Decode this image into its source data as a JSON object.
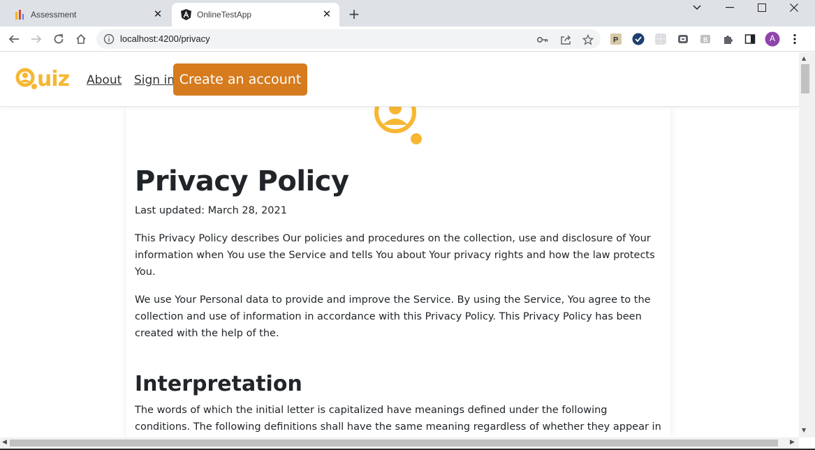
{
  "browser": {
    "tabs": [
      {
        "title": "Assessment",
        "active": false
      },
      {
        "title": "OnlineTestApp",
        "active": true
      }
    ],
    "url": "localhost:4200/privacy",
    "profile_initial": "A"
  },
  "header": {
    "logo_text": "Quiz",
    "nav": {
      "about": "About ",
      "sign_in": "Sign in"
    },
    "cta_label": "Create an account"
  },
  "content": {
    "title": "Privacy Policy",
    "updated": "Last updated: March 28, 2021",
    "paragraphs": [
      "This Privacy Policy describes Our policies and procedures on the collection, use and disclosure of Your information when You use the Service and tells You about Your privacy rights and how the law protects You.",
      "We use Your Personal data to provide and improve the Service. By using the Service, You agree to the collection and use of information in accordance with this Privacy Policy. This Privacy Policy has been created with the help of the."
    ],
    "section_heading": "Interpretation",
    "section_paragraph": "The words of which the initial letter is capitalized have meanings defined under the following conditions. The following definitions shall have the same meaning regardless of whether they appear in singular or in"
  },
  "colors": {
    "brand_orange": "#f7b733",
    "cta_orange": "#d67b1e"
  }
}
